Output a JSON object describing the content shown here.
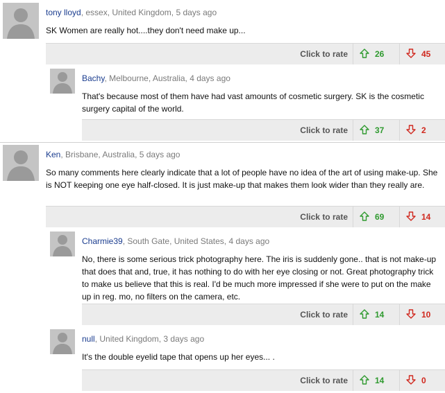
{
  "rate_label": "Click to rate",
  "colors": {
    "author": "#1b3d8f",
    "up": "#2f9a2f",
    "down": "#d0281e",
    "bar": "#ececec"
  },
  "comments": [
    {
      "author": "tony lloyd",
      "meta": ", essex, United Kingdom, 5 days ago",
      "body": "SK Women are really hot....they don't need make up...",
      "up": "26",
      "down": "45"
    },
    {
      "author": "Bachy",
      "meta": ", Melbourne, Australia, 4 days ago",
      "body": "That's because most of them have had vast amounts of cosmetic surgery. SK is the cosmetic surgery capital of the world.",
      "up": "37",
      "down": "2"
    },
    {
      "author": "Ken",
      "meta": ", Brisbane, Australia, 5 days ago",
      "body": "So many comments here clearly indicate that a lot of people have no idea of the art of using make-up. She is NOT keeping one eye half-closed. It is just make-up that makes them look wider than they really are.",
      "up": "69",
      "down": "14"
    },
    {
      "author": "Charmie39",
      "meta": ", South Gate, United States, 4 days ago",
      "body": "No, there is some serious trick photography here. The iris is suddenly gone.. that is not make-up that does that and, true, it has nothing to do with her eye closing or not. Great photography trick to make us believe that this is real. I'd be much more impressed if she were to put on the make up in reg. mo, no filters on the camera, etc.",
      "up": "14",
      "down": "10"
    },
    {
      "author": "null",
      "meta": ", United Kingdom, 3 days ago",
      "body": "It's the double eyelid tape that opens up her eyes... .",
      "up": "14",
      "down": "0"
    }
  ]
}
